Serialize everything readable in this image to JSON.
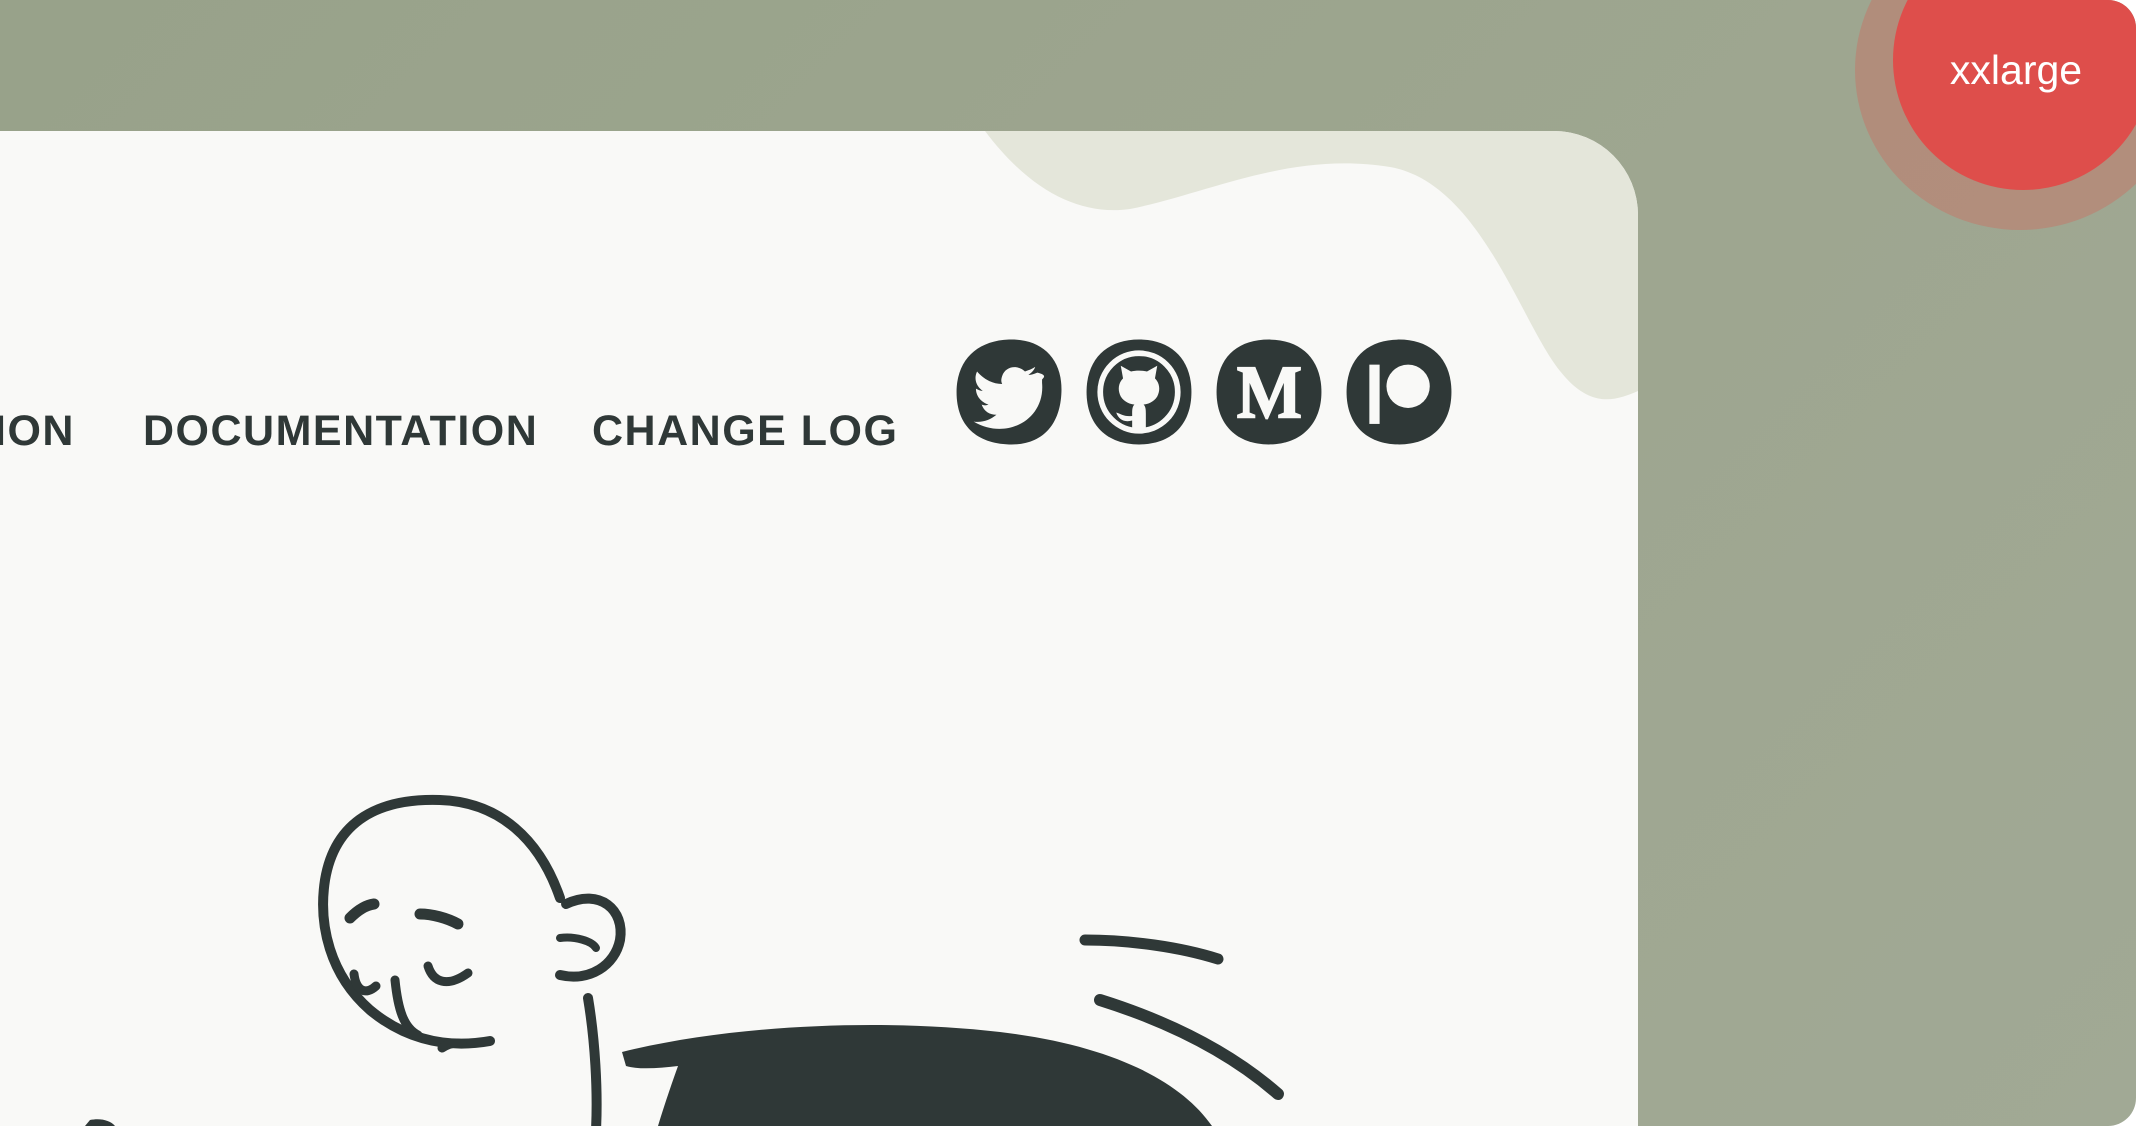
{
  "nav": {
    "items": [
      {
        "label": "ION"
      },
      {
        "label": "DOCUMENTATION"
      },
      {
        "label": "CHANGE LOG"
      }
    ]
  },
  "social": [
    "twitter-icon",
    "github-icon",
    "medium-icon",
    "patreon-icon"
  ],
  "badge": {
    "label": "xxlarge"
  },
  "colors": {
    "background": "#9ca48e",
    "card": "#f9f9f7",
    "blob": "#e4e6da",
    "ink": "#2f3837",
    "badge": "#de4e4b"
  }
}
